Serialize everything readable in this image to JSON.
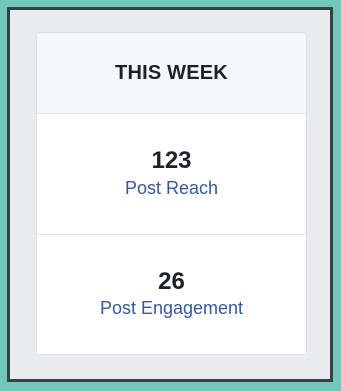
{
  "card": {
    "title": "THIS WEEK",
    "metrics": [
      {
        "value": "123",
        "label": "Post Reach"
      },
      {
        "value": "26",
        "label": "Post Engagement"
      }
    ]
  },
  "colors": {
    "frame": "#72c7ba",
    "frame_border": "#2f4444",
    "page_background": "#e9ebee",
    "header_background": "#f6f7f9",
    "text": "#1d2129",
    "link": "#365899"
  }
}
